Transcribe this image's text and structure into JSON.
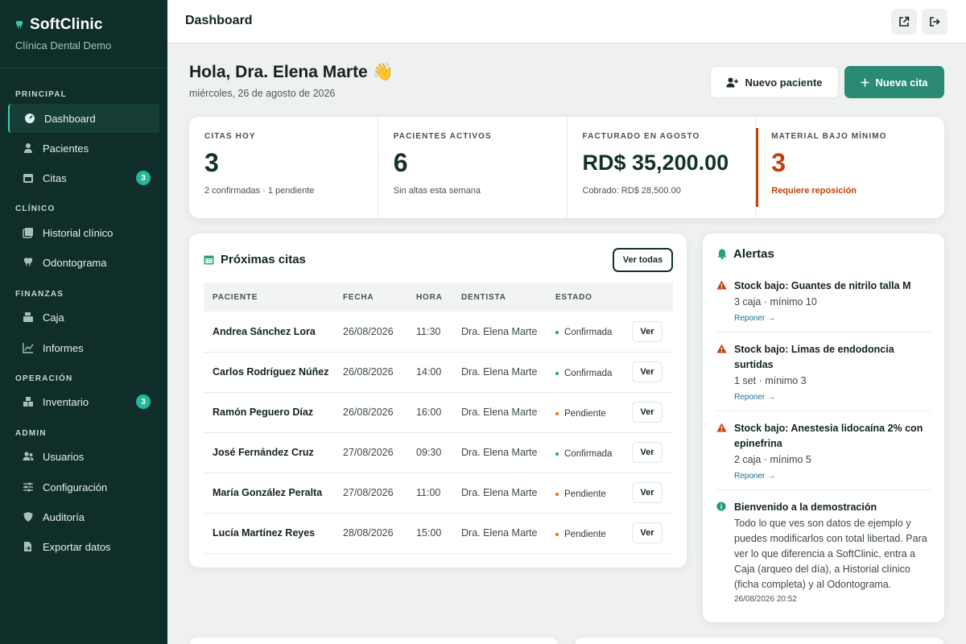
{
  "brand": {
    "name": "SoftClinic",
    "subtitle": "Clínica Dental Demo",
    "logo_icon": "tooth-icon"
  },
  "sidebar": {
    "sections": [
      {
        "label": "PRINCIPAL"
      },
      {
        "label": "CLÍNICO"
      },
      {
        "label": "FINANZAS"
      },
      {
        "label": "OPERACIÓN"
      },
      {
        "label": "ADMIN"
      }
    ],
    "items": [
      {
        "label": "Dashboard",
        "icon": "dashboard-icon",
        "active": true
      },
      {
        "label": "Pacientes",
        "icon": "patient-icon"
      },
      {
        "label": "Citas",
        "icon": "calendar-icon",
        "badge": "3"
      },
      {
        "label": "Historial clínico",
        "icon": "history-icon"
      },
      {
        "label": "Odontograma",
        "icon": "tooth-icon"
      },
      {
        "label": "Caja",
        "icon": "cash-register-icon"
      },
      {
        "label": "Informes",
        "icon": "chart-line-icon"
      },
      {
        "label": "Inventario",
        "icon": "boxes-icon",
        "badge": "3"
      },
      {
        "label": "Usuarios",
        "icon": "users-icon"
      },
      {
        "label": "Configuración",
        "icon": "sliders-icon"
      },
      {
        "label": "Auditoría",
        "icon": "shield-icon"
      },
      {
        "label": "Exportar datos",
        "icon": "export-icon"
      }
    ]
  },
  "topbar": {
    "title": "Dashboard",
    "buttons": [
      "external-link-icon",
      "logout-icon"
    ]
  },
  "greeting": {
    "title": "Hola, Dra. Elena Marte 👋",
    "date": "miércoles, 26 de agosto de 2026"
  },
  "actions": {
    "new_patient": "Nuevo paciente",
    "new_appointment": "Nueva cita"
  },
  "stats": [
    {
      "label": "CITAS HOY",
      "value": "3",
      "sub": "2 confirmadas · 1 pendiente"
    },
    {
      "label": "PACIENTES ACTIVOS",
      "value": "6",
      "sub": "Sin altas esta semana"
    },
    {
      "label": "FACTURADO EN AGOSTO",
      "value": "RD$ 35,200.00",
      "sub": "Cobrado: RD$ 28,500.00"
    },
    {
      "label": "MATERIAL BAJO MÍNIMO",
      "value": "3",
      "sub": "Requiere reposición"
    }
  ],
  "appointments": {
    "title": "Próximas citas",
    "view_all": "Ver todas",
    "columns": [
      "PACIENTE",
      "FECHA",
      "HORA",
      "DENTISTA",
      "ESTADO"
    ],
    "action_label": "Ver",
    "rows": [
      {
        "patient": "Andrea Sánchez Lora",
        "date": "26/08/2026",
        "time": "11:30",
        "dentist": "Dra. Elena Marte",
        "status": "Confirmada"
      },
      {
        "patient": "Carlos Rodríguez Núñez",
        "date": "26/08/2026",
        "time": "14:00",
        "dentist": "Dra. Elena Marte",
        "status": "Confirmada"
      },
      {
        "patient": "Ramón Peguero Díaz",
        "date": "26/08/2026",
        "time": "16:00",
        "dentist": "Dra. Elena Marte",
        "status": "Pendiente"
      },
      {
        "patient": "José Fernández Cruz",
        "date": "27/08/2026",
        "time": "09:30",
        "dentist": "Dra. Elena Marte",
        "status": "Confirmada"
      },
      {
        "patient": "María González Peralta",
        "date": "27/08/2026",
        "time": "11:00",
        "dentist": "Dra. Elena Marte",
        "status": "Pendiente"
      },
      {
        "patient": "Lucía Martínez Reyes",
        "date": "28/08/2026",
        "time": "15:00",
        "dentist": "Dra. Elena Marte",
        "status": "Pendiente"
      }
    ]
  },
  "alerts": {
    "title": "Alertas",
    "items": [
      {
        "type": "warning",
        "title": "Stock bajo: Guantes de nitrilo talla M",
        "text": "3 caja · mínimo 10",
        "link": "Reponer →"
      },
      {
        "type": "warning",
        "title": "Stock bajo: Limas de endodoncia surtidas",
        "text": "1 set · mínimo 3",
        "link": "Reponer →"
      },
      {
        "type": "warning",
        "title": "Stock bajo: Anestesia lidocaína 2% con epinefrina",
        "text": "2 caja · mínimo 5",
        "link": "Reponer →"
      },
      {
        "type": "info",
        "title": "Bienvenido a la demostración",
        "text": "Todo lo que ves son datos de ejemplo y puedes modificarlos con total libertad. Para ver lo que diferencia a SoftClinic, entra a Caja (arqueo del día), a Historial clínico (ficha completa) y al Odontograma.",
        "time": "26/08/2026 20:52"
      }
    ]
  },
  "colors": {
    "sidebar": "#0f2e29",
    "accent": "#2a8a74",
    "confirmed": "#23a07f",
    "pending": "#d97706",
    "warning": "#c2410c",
    "info": "#1f9d74"
  }
}
